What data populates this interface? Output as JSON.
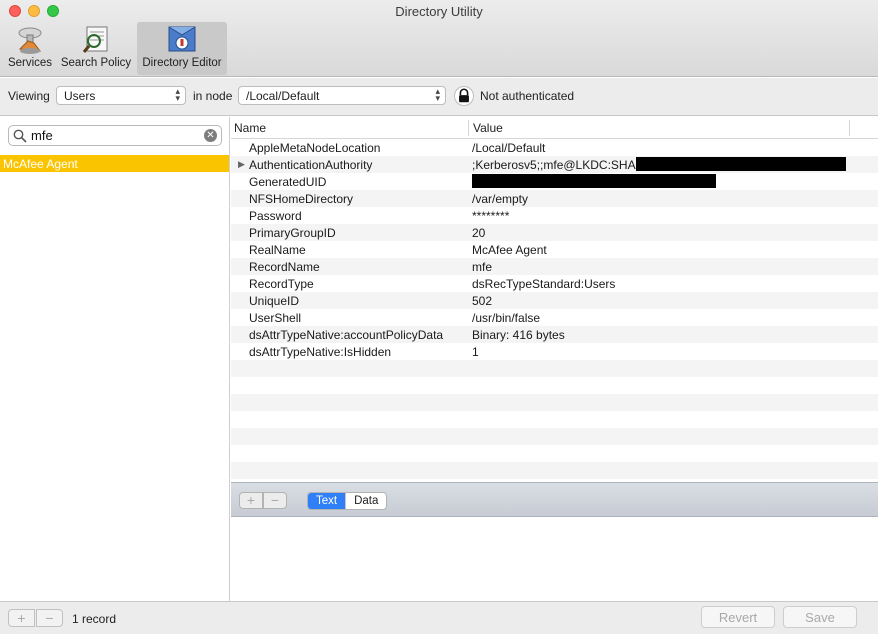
{
  "window": {
    "title": "Directory Utility"
  },
  "toolbar": [
    {
      "label": "Services",
      "icon": "services-icon"
    },
    {
      "label": "Search Policy",
      "icon": "search-policy-icon"
    },
    {
      "label": "Directory Editor",
      "icon": "directory-editor-icon",
      "active": true
    }
  ],
  "viewbar": {
    "viewing_label": "Viewing",
    "viewing_value": "Users",
    "node_label": "in node",
    "node_value": "/Local/Default",
    "auth_status": "Not authenticated"
  },
  "sidebar": {
    "search_value": "mfe",
    "search_placeholder": "",
    "records": [
      "McAfee Agent"
    ],
    "selected_color": "#fbc400"
  },
  "table": {
    "col_name": "Name",
    "col_value": "Value",
    "rows": [
      {
        "name": "AppleMetaNodeLocation",
        "value": "/Local/Default"
      },
      {
        "name": "AuthenticationAuthority",
        "value": ";Kerberosv5;;mfe@LKDC:SHA1.8",
        "expandable": true,
        "redacted": true
      },
      {
        "name": "GeneratedUID",
        "value": "",
        "redacted": true
      },
      {
        "name": "NFSHomeDirectory",
        "value": "/var/empty"
      },
      {
        "name": "Password",
        "value": "********"
      },
      {
        "name": "PrimaryGroupID",
        "value": "20"
      },
      {
        "name": "RealName",
        "value": "McAfee Agent"
      },
      {
        "name": "RecordName",
        "value": "mfe"
      },
      {
        "name": "RecordType",
        "value": "dsRecTypeStandard:Users"
      },
      {
        "name": "UniqueID",
        "value": "502"
      },
      {
        "name": "UserShell",
        "value": "/usr/bin/false"
      },
      {
        "name": "dsAttrTypeNative:accountPolicyData",
        "value": "Binary: 416 bytes"
      },
      {
        "name": "dsAttrTypeNative:IsHidden",
        "value": "1"
      }
    ]
  },
  "editor": {
    "add": "+",
    "remove": "−",
    "text_tab": "Text",
    "data_tab": "Data"
  },
  "status": {
    "add": "+",
    "remove": "−",
    "count": "1 record",
    "revert": "Revert",
    "save": "Save"
  }
}
